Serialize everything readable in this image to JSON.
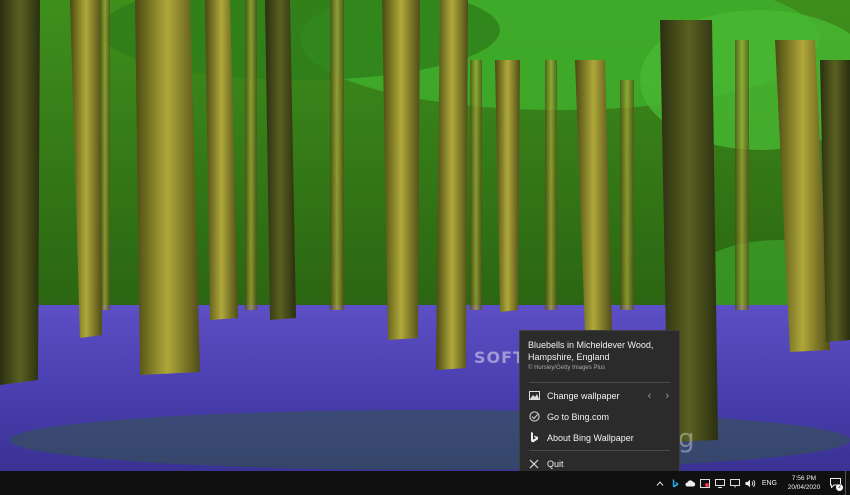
{
  "popup": {
    "title_line1": "Bluebells in Micheldever Wood,",
    "title_line2": "Hampshire, England",
    "copyright": "© Hursley/Getty Images Plus",
    "items": [
      {
        "label": "Change wallpaper",
        "icon": "image-icon"
      },
      {
        "label": "Go to Bing.com",
        "icon": "globe-icon"
      },
      {
        "label": "About Bing Wallpaper",
        "icon": "bing-logo-icon"
      },
      {
        "label": "Quit",
        "icon": "close-icon"
      }
    ],
    "prev_arrow": "‹",
    "next_arrow": "›"
  },
  "watermark": "SOFTPEDIA",
  "bg_glyph": "g",
  "taskbar": {
    "language": "ENG",
    "time": "7:56 PM",
    "date": "20/04/2020",
    "notification_count": "2",
    "tray_icons": [
      "chevron-up-icon",
      "bing-tray-icon",
      "cloud-icon",
      "security-icon",
      "network-icon",
      "display-icon",
      "volume-icon"
    ]
  },
  "colors": {
    "popup_bg": "#2b2b2b",
    "taskbar_bg": "#101010",
    "bluebell": "#5a4fc8"
  }
}
